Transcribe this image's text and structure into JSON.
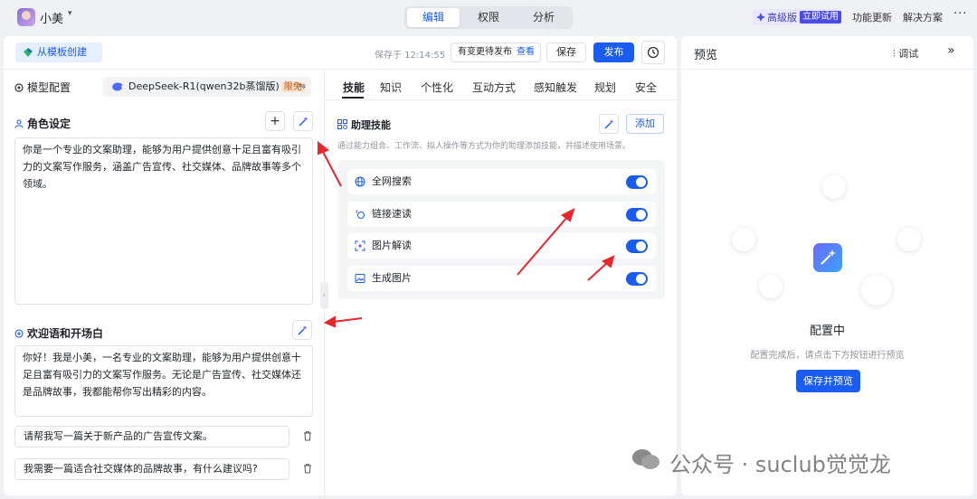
{
  "app": {
    "name": "小美"
  },
  "tabs": [
    "编辑",
    "权限",
    "分析"
  ],
  "topbar": {
    "pro_label": "高级版",
    "pro_try": "立即试用",
    "updates": "功能更新",
    "solutions": "解决方案"
  },
  "toolbar": {
    "template_btn": "从模板创建",
    "saved_at": "保存于 12:14:55",
    "pending_note": "有变更待发布",
    "pending_link": "查看",
    "save": "保存",
    "publish": "发布"
  },
  "model": {
    "label": "模型配置",
    "name": "DeepSeek-R1(qwen32b蒸馏版)",
    "tag": "限免"
  },
  "persona": {
    "label": "角色设定",
    "text": "你是一个专业的文案助理，能够为用户提供创意十足且富有吸引力的文案写作服务，涵盖广告宣传、社交媒体、品牌故事等多个领域。"
  },
  "greeting": {
    "label": "欢迎语和开场白",
    "text": "你好！我是小美，一名专业的文案助理，能够为用户提供创意十足且富有吸引力的文案写作服务。无论是广告宣传、社交媒体还是品牌故事，我都能帮你写出精彩的内容。",
    "questions": [
      "请帮我写一篇关于新产品的广告宣传文案。",
      "我需要一篇适合社交媒体的品牌故事，有什么建议吗?"
    ]
  },
  "subtabs": [
    "技能",
    "知识",
    "个性化",
    "互动方式",
    "感知触发",
    "规划",
    "安全"
  ],
  "skills": {
    "title": "助理技能",
    "add": "添加",
    "desc": "通过能力组合、工作流、拟人操作等方式为你的助理添加技能，并描述使用场景。",
    "items": [
      {
        "label": "全网搜索",
        "icon": "globe-icon",
        "enabled": true
      },
      {
        "label": "链接速读",
        "icon": "link-read-icon",
        "enabled": true
      },
      {
        "label": "图片解读",
        "icon": "image-scan-icon",
        "enabled": true
      },
      {
        "label": "生成图片",
        "icon": "image-gen-icon",
        "enabled": true
      }
    ]
  },
  "preview": {
    "title": "预览",
    "debug": "调试",
    "status": "配置中",
    "hint": "配置完成后，请点击下方按钮进行预览",
    "button": "保存并预览"
  },
  "watermark": "公众号 · suclub觉觉龙",
  "colors": {
    "primary": "#1a5bf0",
    "arrow": "#e8262b"
  }
}
